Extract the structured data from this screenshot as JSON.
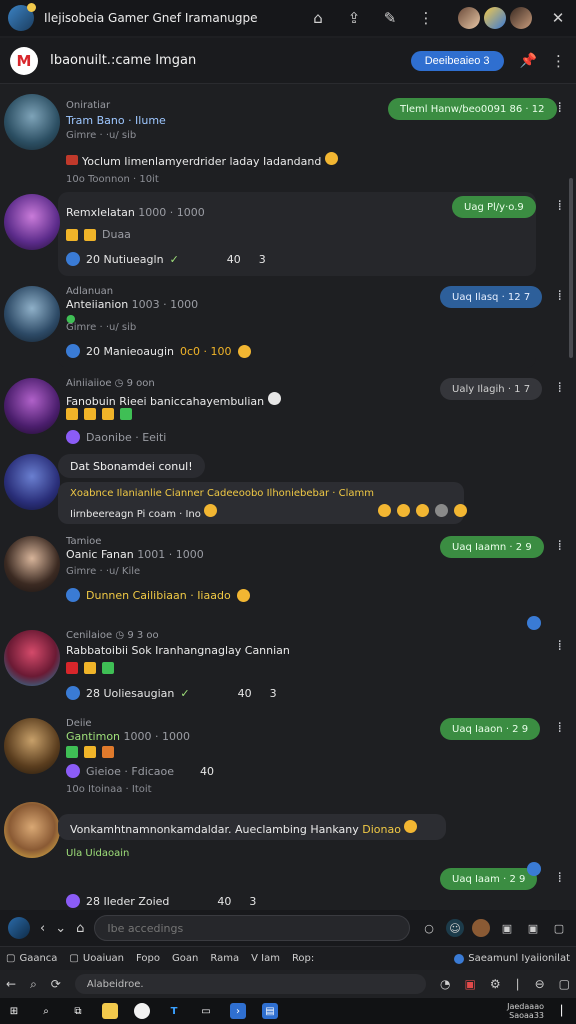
{
  "window": {
    "title": "Ilejisobeia Gamer Gnef Iramanugpe"
  },
  "channel": {
    "name": "Ibaonuilt.:came Imgan",
    "logo_letter": "M",
    "join_label": "Deeibeaieo 3"
  },
  "messages": [
    {
      "meta": "Oniratiar",
      "name": "Tram Bano · Ilume",
      "sub": "Gimre · ·u/ sib",
      "text": "Yoclum Iimenlamyerdrider laday Iadandand",
      "foot": "10o Toonnon · 10it",
      "pill": "Tleml Hanw/beo0091 86 · 12"
    },
    {
      "name": "Remxlelatan",
      "time": "1000 · 1000",
      "sub": "Duaa",
      "react": "20 Nutiueagln",
      "count1": "40",
      "count2": "3",
      "pill": "Uag Pl/y·o.9"
    },
    {
      "meta": "Adlanuan",
      "name": "Anteiianion",
      "time": "1003 · 1000",
      "sub": "Gimre · ·u/ sib",
      "react": "20 Manieoaugin",
      "react2": "0c0 · 100",
      "pill": "Uaq Ilasq · 12 7"
    },
    {
      "meta": "Ainiiaiioe",
      "time": "9 oon",
      "name": "Fanobuin Rieei baniccahayembulian",
      "sub": "Daonibe · Eeiti",
      "pill": "Ualy Ilagih · 1 7"
    },
    {
      "name": "Dat Sbonamdei conul!",
      "text": "Xoabnce Ilanianlie Cianner Cadeeoobo Ilhoniebebar · Clamm",
      "text2": "Iirnbeereagn Pi coam · Ino"
    },
    {
      "meta": "Tamioe",
      "name": "Oanic Fanan",
      "time": "1001 · 1000",
      "sub": "Gimre · ·u/ Kile",
      "react": "Dunnen Cailibiaan · Iiaado",
      "pill": "Uaq Iaamn · 2 9"
    },
    {
      "meta": "Cenilaioe",
      "time": "9 3 oo",
      "name": "Rabbatoibii Sok Iranhangnaglay Cannian",
      "react": "28 Uoliesaugian",
      "count1": "40",
      "count2": "3"
    },
    {
      "meta": "Deiie",
      "name": "Gantimon",
      "time": "1000 · 1000",
      "sub": "Gieioe · Fdicaoe",
      "foot": "10o Itoinaa · Itoit",
      "count1": "40",
      "pill": "Uaq Iaaon · 2 9"
    },
    {
      "name": "Vonkamhtnamnonkamdaldar. Aueclambing Hankany",
      "name2": "Dionao",
      "sub": "Ula Uidaoain",
      "react": "28 Ileder Zoied",
      "count1": "40",
      "count2": "3",
      "pill": "Uaq Iaam · 2 9"
    }
  ],
  "composer": {
    "placeholder": "Ibe accedings"
  },
  "tabs": [
    {
      "label": "Gaanca"
    },
    {
      "label": "Uoaiuan"
    },
    {
      "label": "Fopo"
    },
    {
      "label": "Goan"
    },
    {
      "label": "Rama"
    },
    {
      "label": "V Iam"
    },
    {
      "label": "Rop:"
    }
  ],
  "tab_right": "Saeamunl Iyaiionilat",
  "nav": {
    "address": "Alabeidroe."
  },
  "taskbar": {
    "time_line1": "Jaedaaao",
    "time_line2": "Saoaa33"
  },
  "colors": {
    "accent_blue": "#2f6fd0",
    "pill_green": "#3b8d42",
    "pill_blue": "#2d5f9a"
  }
}
